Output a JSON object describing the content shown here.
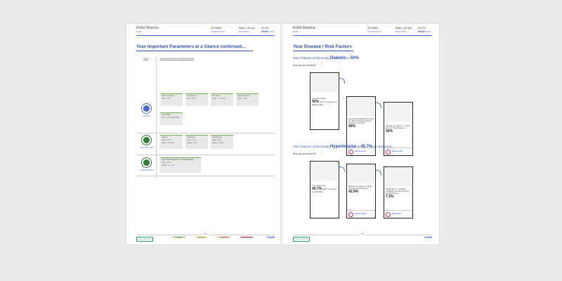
{
  "left_page": {
    "patient_name": "Rohit Sharma",
    "name_label": "NAME",
    "accession": "3134554",
    "accession_label": "ACCESSION NO",
    "basic_info": "Male | 44 yrs",
    "basic_info_label": "BASIC INFO",
    "date": "30-04-2023",
    "date_label": "DATE OF TEST",
    "title": "Your Important Parameters at a Glance continued...",
    "col_profile": "Profile",
    "col_params": "Important parameters in respective profile",
    "profiles": [
      {
        "name": "UREATES",
        "cards": [
          {
            "name": "Serum Glucose",
            "value": "Value : 995"
          },
          {
            "name": "S.E.Albumin",
            "value": "Value : 965"
          },
          {
            "name": "Pus Cells",
            "value": "Value : 2 - 4 /HPF"
          },
          {
            "name": "Specific Gravity",
            "value": "Value : 1.023"
          },
          {
            "name": "Urine RBC",
            "value": "Value : NIL DETECTED"
          }
        ]
      },
      {
        "name": "ELECTROLYTES",
        "cards": [
          {
            "name": "Sodium",
            "value": "Value : 139.7",
            "range": "Range : 136-146"
          },
          {
            "name": "Potassium",
            "value": "Value : 4.73",
            "range": "Range : 3.5-5"
          },
          {
            "name": "Phosphorus",
            "value": "Value : 3.38",
            "range": "Range : 2.5-4.5"
          }
        ]
      },
      {
        "name": "LIVER ENZYMES",
        "cards": [
          {
            "name": "PROSTATE SPECIFIC ANTIGEN(PSA)",
            "value": "Value : 0.88",
            "range": "Range : 0.0 - 4.0"
          }
        ]
      }
    ],
    "page_number": "8/20",
    "logo_text": "Your Logo Here",
    "legend": [
      "Normal",
      "Borderline",
      "Abnormal",
      "Very Abnormal"
    ],
    "brand": "Health"
  },
  "right_page": {
    "patient_name": "Rohit Sharma",
    "name_label": "NAME",
    "accession": "3134554",
    "accession_label": "ACCESSION NO",
    "basic_info": "Male | 44 yrs",
    "basic_info_label": "BASIC INFO",
    "date": "30-04-2023",
    "date_label": "DATE OF TEST",
    "title": "Your Disease / Risk Factors",
    "diabetic": {
      "heading_pre": "Your chances of becoming ",
      "heading_key": "Diabetic",
      "heading_post": " is ",
      "heading_val": "50%",
      "reduce": "How can you reduce it?",
      "box1_text": "Your present risk is",
      "box1_big": "50%",
      "box1_rest": "which, for your age, is a Moderate Risk.",
      "box2_text": "Exercising for atleast 150 minutes per week at moderate intensity will reduce your risk to",
      "box2_big": "40%",
      "box2_btn": "Start Exercise",
      "box3_text": "Decrease your waist to <= 90 cm and your risk will reduce to",
      "box3_big": "30%",
      "box3_btn": "Reduce waist"
    },
    "hypertensive": {
      "heading_pre": "Your chances of becoming ",
      "heading_key": "Hypertensive",
      "heading_post": " is ",
      "heading_val": "49.7%",
      "heading_tail": " (in next 4 yrs)",
      "reduce": "How can you reduce it?",
      "box1_text": "Your present risk is",
      "box1_big": "49.7%",
      "box1_rest": "which, for your age, is a High Risk.",
      "box2_text": "Reduce your weight to 72.69 kg and your risk will reduce to",
      "box2_big": "42.9%",
      "box2_btn": "Reduce weight",
      "box3_text": "Reduce BP to <= 120/80 by consulting your doctor and your risk will reduce to",
      "box3_big": "7.3%",
      "box3_btn": "Reduce BP"
    },
    "page_number": "7/20",
    "logo_text": "Your Logo Here",
    "brand": "Health"
  },
  "colors": {
    "accent": "#2c4db3",
    "normal": "#6ab04c",
    "borderline": "#f0c040",
    "abnormal": "#e08040",
    "very_abnormal": "#d03030"
  }
}
